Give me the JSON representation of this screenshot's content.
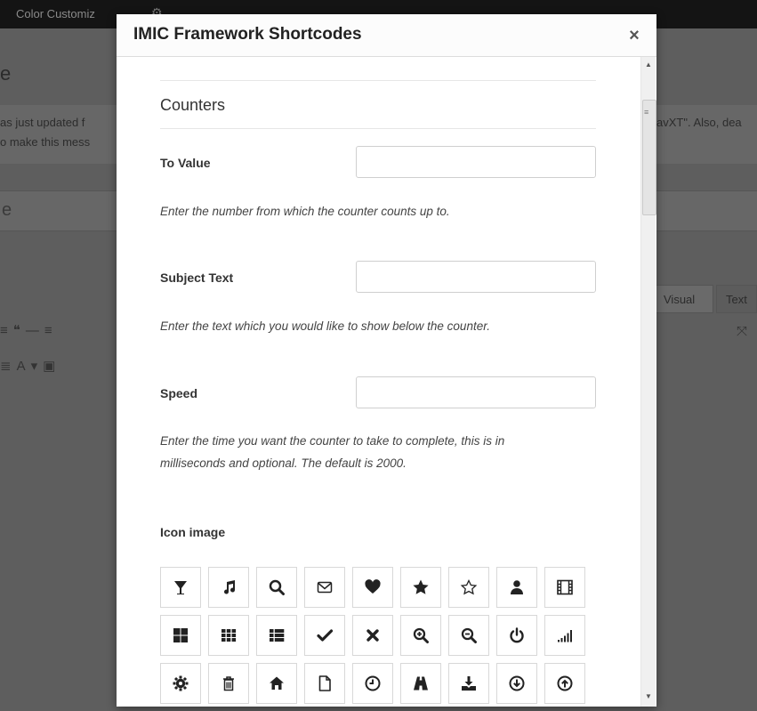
{
  "background": {
    "topbar_label": "Color Customiz",
    "heading_char": "e",
    "notice_line_1": "as just updated f",
    "notice_line_2": "o make this mess",
    "notice_right": "avXT\". Also, dea",
    "title_char": "e",
    "tab_visual": "Visual",
    "tab_text": "Text"
  },
  "modal": {
    "title": "IMIC Framework Shortcodes",
    "close_label": "×",
    "section_title": "Counters",
    "fields": [
      {
        "label": "To Value",
        "value": "",
        "help": "Enter the number from which the counter counts up to."
      },
      {
        "label": "Subject Text",
        "value": "",
        "help": "Enter the text which you would like to show below the counter."
      },
      {
        "label": "Speed",
        "value": "",
        "help_line_1": "Enter the time you want the counter to take to complete, this is in",
        "help_line_2": "milliseconds and optional. The default is 2000."
      }
    ],
    "icon_label": "Icon image",
    "icons": [
      [
        "glass-icon",
        "music-icon",
        "search-icon",
        "envelope-icon",
        "heart-icon",
        "star-icon",
        "star-empty-icon",
        "user-icon",
        "film-icon"
      ],
      [
        "th-large-icon",
        "th-icon",
        "th-list-icon",
        "ok-icon",
        "remove-icon",
        "zoom-in-icon",
        "zoom-out-icon",
        "off-icon",
        "signal-icon"
      ],
      [
        "cog-icon",
        "trash-icon",
        "home-icon",
        "file-icon",
        "time-icon",
        "road-icon",
        "download-alt-icon",
        "download-icon",
        "upload-icon"
      ]
    ]
  }
}
